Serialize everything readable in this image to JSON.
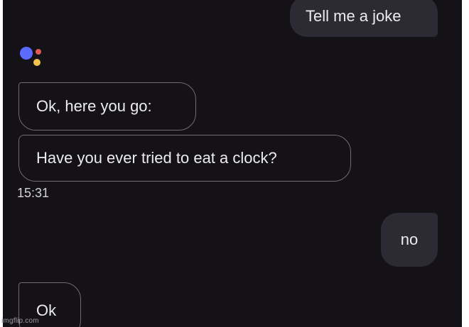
{
  "conversation": {
    "messages": [
      {
        "sender": "user",
        "text": "Tell me a joke"
      },
      {
        "sender": "assistant",
        "text": "Ok, here you go:"
      },
      {
        "sender": "assistant",
        "text": "Have you ever tried to eat a clock?"
      },
      {
        "sender": "user",
        "text": "no"
      },
      {
        "sender": "assistant",
        "text": "Ok"
      }
    ],
    "timestamp": "15:31"
  },
  "assistant_logo": {
    "icon": "google-assistant-icon",
    "colors": [
      "#5c6bff",
      "#e05a4f",
      "#f2c14e"
    ]
  },
  "watermark": {
    "text": "imgflip.com"
  },
  "theme": {
    "background": "#141217",
    "user_bubble": "#2c2b33",
    "assistant_border": "#6d6b74",
    "text": "#ecebef"
  }
}
